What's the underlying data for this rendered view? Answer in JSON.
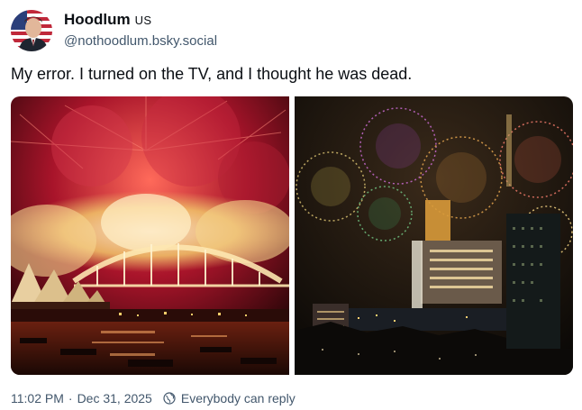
{
  "author": {
    "display_name": "Hoodlum",
    "flag": "US",
    "handle": "@nothoodlum.bsky.social",
    "avatar_icon": "person-avatar-with-flag"
  },
  "post": {
    "text": "My error. I turned on the TV, and I thought he was dead."
  },
  "images": [
    {
      "icon": "fireworks-harbour-bridge-photo"
    },
    {
      "icon": "fireworks-city-skyline-photo"
    }
  ],
  "footer": {
    "time": "11:02 PM",
    "separator": "·",
    "date": "Dec 31, 2025",
    "reply_setting": "Everybody can reply",
    "reply_icon": "globe-icon"
  },
  "colors": {
    "text_primary": "#0b0f14",
    "text_secondary": "#42576c"
  }
}
